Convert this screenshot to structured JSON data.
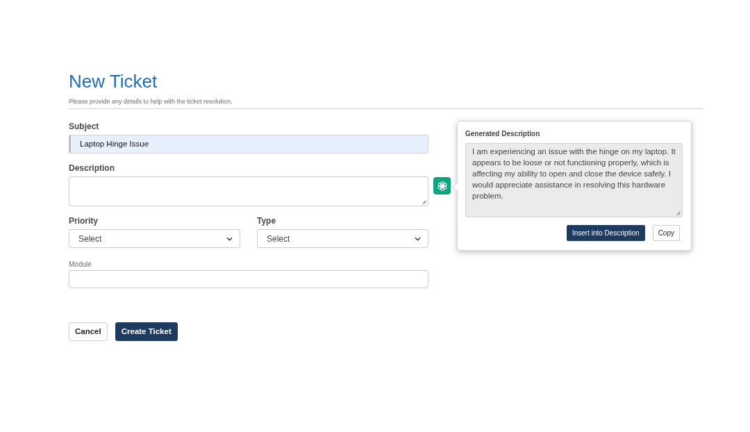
{
  "page": {
    "title": "New Ticket",
    "subtitle": "Please provide any details to help with the ticket resolution."
  },
  "form": {
    "subject": {
      "label": "Subject",
      "value": "Laptop Hinge Issue"
    },
    "description": {
      "label": "Description"
    },
    "priority": {
      "label": "Priority",
      "value": "Select"
    },
    "type": {
      "label": "Type",
      "value": "Select"
    },
    "module": {
      "label": "Module"
    }
  },
  "generated_description": {
    "title": "Generated Description",
    "text": "I am experiencing an issue with the hinge on my laptop. It appears to be loose or not functioning properly, which is affecting my ability to open and close the device safely. I would appreciate assistance in resolving this hardware problem.",
    "buttons": [
      {
        "label": "Insert into Description",
        "kind": "primary"
      },
      {
        "label": "Copy",
        "kind": "secondary"
      }
    ]
  },
  "actions": [
    {
      "label": "Cancel",
      "kind": "secondary"
    },
    {
      "label": "Create Ticket",
      "kind": "primary"
    }
  ]
}
